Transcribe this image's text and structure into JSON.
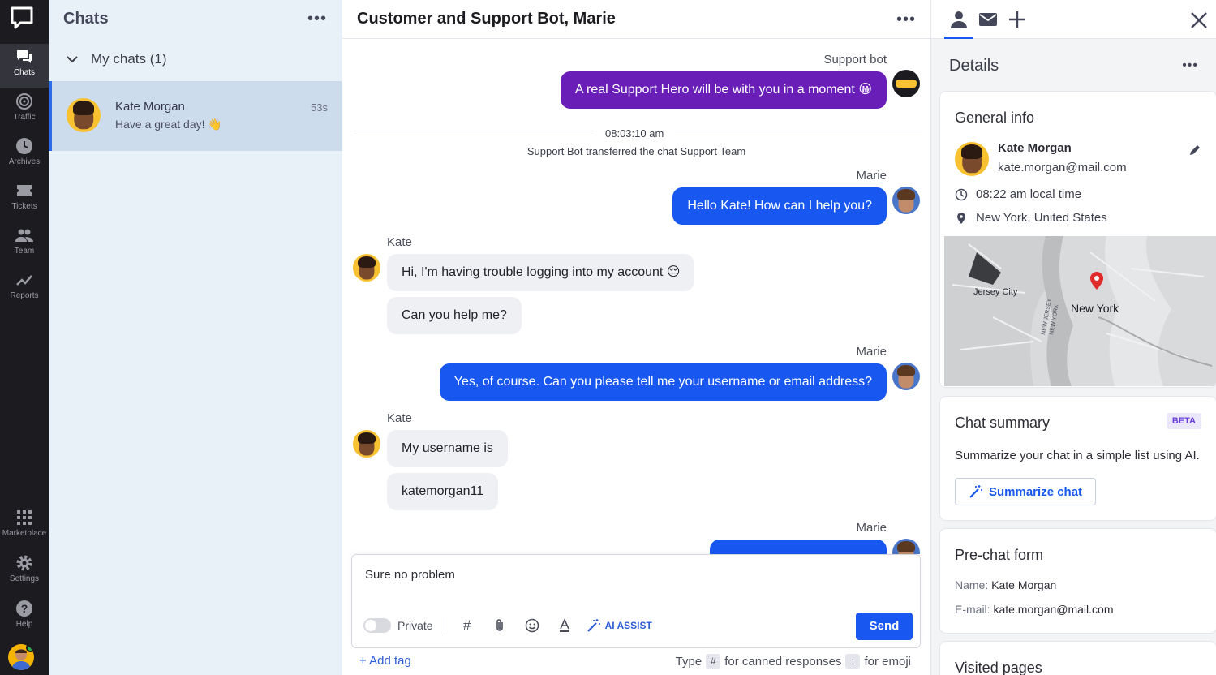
{
  "nav": {
    "items": [
      {
        "label": "Chats"
      },
      {
        "label": "Traffic"
      },
      {
        "label": "Archives"
      },
      {
        "label": "Tickets"
      },
      {
        "label": "Team"
      },
      {
        "label": "Reports"
      }
    ],
    "bottom": [
      {
        "label": "Marketplace"
      },
      {
        "label": "Settings"
      },
      {
        "label": "Help"
      }
    ]
  },
  "chats_panel": {
    "title": "Chats",
    "group_label": "My chats (1)",
    "chats": [
      {
        "name": "Kate Morgan",
        "preview": "Have a great day! 👋",
        "time": "53s"
      }
    ]
  },
  "conversation": {
    "title": "Customer and Support Bot, Marie",
    "messages": [
      {
        "sender": "Support bot",
        "text": "A real Support Hero will be with you in a moment 😀"
      },
      {
        "system_time": "08:03:10 am",
        "system_text": "Support Bot transferred the chat Support Team"
      },
      {
        "sender": "Marie",
        "text": "Hello Kate! How can I help you?"
      },
      {
        "sender": "Kate",
        "text": "Hi, I'm having trouble logging into my account 😔"
      },
      {
        "text": "Can you help me?"
      },
      {
        "sender": "Marie",
        "text": "Yes, of course. Can you please tell me your username or email address?"
      },
      {
        "sender": "Kate",
        "text": "My username is"
      },
      {
        "text": "katemorgan11"
      },
      {
        "sender": "Marie",
        "text": ""
      }
    ],
    "composer": {
      "text": "Sure no problem",
      "private_label": "Private",
      "ai_label": "AI ASSIST",
      "send_label": "Send",
      "add_tag": "+ Add tag",
      "hint_type": "Type",
      "hint_hash": "#",
      "hint_canned": "for canned responses",
      "hint_colon": ":",
      "hint_emoji": "for emoji"
    }
  },
  "details": {
    "title": "Details",
    "general": {
      "title": "General info",
      "name": "Kate Morgan",
      "email": "kate.morgan@mail.com",
      "local_time": "08:22 am local time",
      "location": "New York, United States",
      "map_labels": [
        "Jersey City",
        "New York",
        "NEW JERSEY",
        "NEW YORK"
      ]
    },
    "summary": {
      "title": "Chat summary",
      "badge": "BETA",
      "text": "Summarize your chat in a simple list using AI.",
      "button": "Summarize chat"
    },
    "prechat": {
      "title": "Pre-chat form",
      "name_key": "Name:",
      "name_val": "Kate Morgan",
      "email_key": "E-mail:",
      "email_val": "kate.morgan@mail.com"
    },
    "visited": {
      "title": "Visited pages"
    }
  },
  "colors": {
    "accent": "#1857f0",
    "bot": "#6a1eb8",
    "nav_bg": "#1b1b20",
    "list_bg": "#e9f1f8"
  }
}
